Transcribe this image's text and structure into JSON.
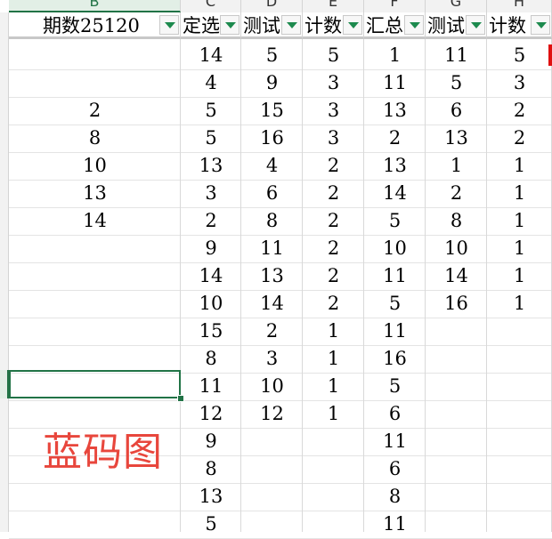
{
  "column_letters": [
    "B",
    "C",
    "D",
    "E",
    "F",
    "G",
    "H"
  ],
  "headers": [
    {
      "label": "期数25120"
    },
    {
      "label": "定选"
    },
    {
      "label": "测试"
    },
    {
      "label": "计数"
    },
    {
      "label": "汇总"
    },
    {
      "label": "测试"
    },
    {
      "label": "计数"
    }
  ],
  "columns": {
    "B": [
      "",
      "",
      "2",
      "8",
      "10",
      "13",
      "14",
      "",
      "",
      "",
      "",
      "",
      "",
      "",
      "",
      "",
      "",
      ""
    ],
    "C": [
      "14",
      "4",
      "5",
      "5",
      "13",
      "3",
      "2",
      "9",
      "14",
      "10",
      "15",
      "8",
      "11",
      "12",
      "9",
      "8",
      "13",
      "5"
    ],
    "D": [
      "5",
      "9",
      "15",
      "16",
      "4",
      "6",
      "8",
      "11",
      "13",
      "14",
      "2",
      "3",
      "10",
      "12",
      "",
      "",
      "",
      ""
    ],
    "E": [
      "5",
      "3",
      "3",
      "3",
      "2",
      "2",
      "2",
      "2",
      "2",
      "2",
      "1",
      "1",
      "1",
      "1",
      "",
      "",
      "",
      ""
    ],
    "F": [
      "1",
      "11",
      "13",
      "2",
      "13",
      "14",
      "5",
      "10",
      "11",
      "5",
      "11",
      "16",
      "5",
      "6",
      "11",
      "6",
      "8",
      "11"
    ],
    "G": [
      "11",
      "5",
      "6",
      "13",
      "1",
      "2",
      "8",
      "10",
      "14",
      "16",
      "",
      "",
      "",
      "",
      "",
      "",
      "",
      ""
    ],
    "H": [
      "5",
      "3",
      "2",
      "2",
      "1",
      "1",
      "1",
      "1",
      "1",
      "1",
      "",
      "",
      "",
      "",
      "",
      "",
      "",
      ""
    ]
  },
  "overlay_text": "蓝码图",
  "colors": {
    "selection": "#217346",
    "filter_arrow": "#1d8a4e",
    "overlay_text": "#e8463c",
    "marker": "#e01010"
  }
}
